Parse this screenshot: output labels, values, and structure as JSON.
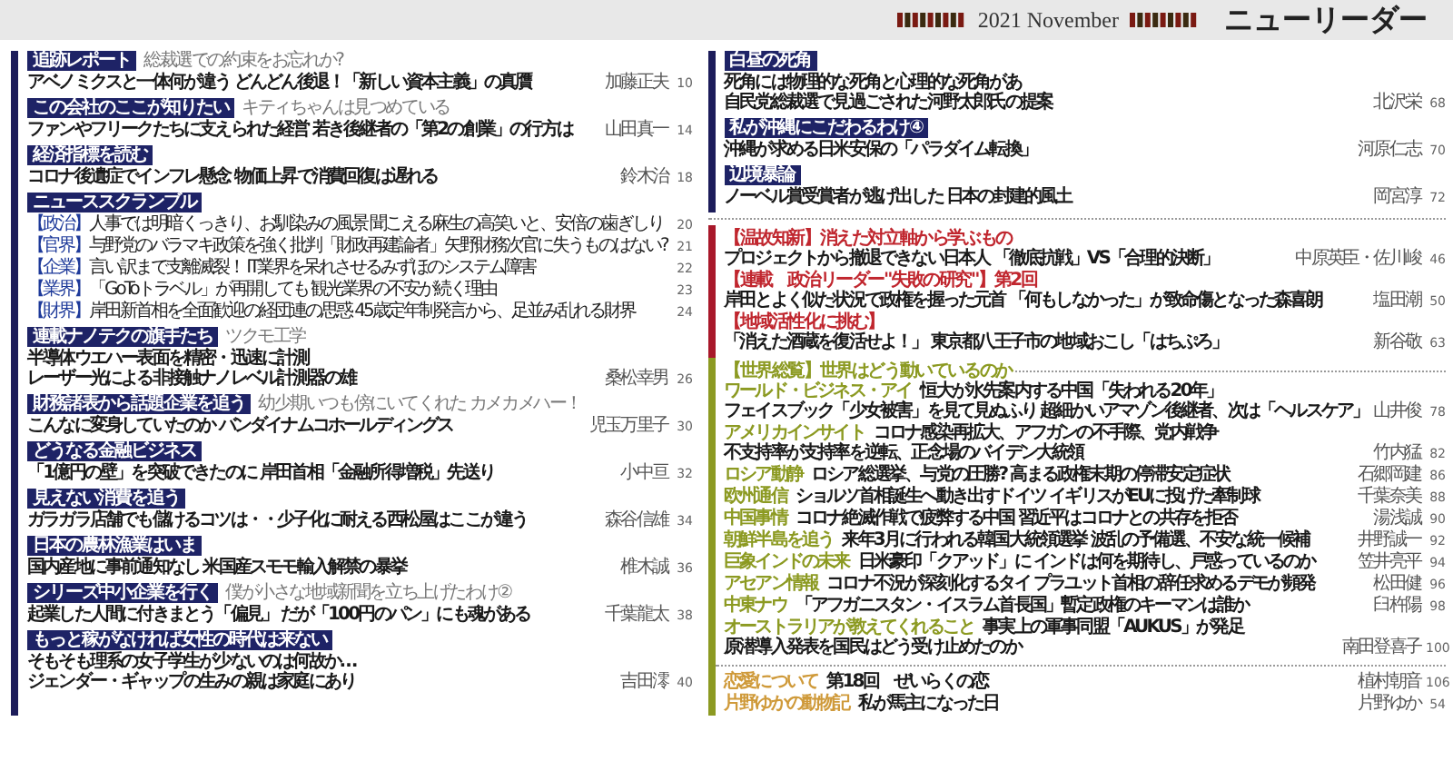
{
  "header": {
    "edition": "2021 November",
    "logo": "ニューリーダー"
  },
  "left_column": {
    "sections": [
      {
        "kind": "article",
        "tag": "追跡レポート",
        "subtitle": "総裁選での約束をお忘れか?",
        "lines": [
          "アベノミクスと一体何が違う どんどん後退！「新しい資本主義」の真贋"
        ],
        "author": "加藤正夫",
        "page": "10"
      },
      {
        "kind": "article",
        "tag": "この会社のここが知りたい",
        "subtitle": "キティちゃんは見つめている",
        "lines": [
          "ファンやフリークたちに支えられた経営 若き後継者の「第2の創業」の行方は"
        ],
        "author": "山田真一",
        "page": "14"
      },
      {
        "kind": "article",
        "tag": "経済指標を読む",
        "lines": [
          "コロナ後遺症でインフレ懸念 物価上昇で消費回復は遅れる"
        ],
        "author": "鈴木治",
        "page": "18"
      },
      {
        "kind": "news",
        "tag": "ニューススクランブル",
        "news": [
          {
            "category": "【政治】",
            "text": "人事では明暗くっきり、お馴染みの風景 聞こえる麻生の高笑いと、安倍の歯ぎしり",
            "page": "20"
          },
          {
            "category": "【官界】",
            "text": "与野党のバラマキ政策を強く批判「財政再建論者」矢野財務次官に失うものはない?",
            "page": "21"
          },
          {
            "category": "【企業】",
            "text": "言い訳まで支離滅裂！ IT業界を呆れさせるみずほのシステム障害",
            "page": "22"
          },
          {
            "category": "【業界】",
            "text": "「GoToトラベル」が再開しても 観光業界の不安が続く理由",
            "page": "23"
          },
          {
            "category": "【財界】",
            "text": "岸田新首相を全面歓迎の経団連の思惑 45歳定年制発言から、足並み乱れる財界",
            "page": "24"
          }
        ]
      },
      {
        "kind": "article",
        "tag": "連載ナノテクの旗手たち",
        "subtitle": "ツクモ工学",
        "lines": [
          "半導体ウエハー表面を精密・迅速に計測",
          "レーザー光による非接触ナノレベル計測器の雄"
        ],
        "author": "桑松幸男",
        "page": "26"
      },
      {
        "kind": "article",
        "tag": "財務諸表から話題企業を追う",
        "subtitle": "幼少期いつも傍にいてくれた カメカメハー！",
        "lines": [
          "こんなに変身していたのか バンダイナムコホールディングス"
        ],
        "author": "児玉万里子",
        "page": "30"
      },
      {
        "kind": "article",
        "tag": "どうなる金融ビジネス",
        "lines": [
          "「1億円の壁」を突破できたのに 岸田首相「金融所得増税」先送り"
        ],
        "author": "小中亘",
        "page": "32"
      },
      {
        "kind": "article",
        "tag": "見えない消費を追う",
        "lines": [
          "ガラガラ店舗でも儲けるコツは・・少子化に耐える西松屋はここが違う"
        ],
        "author": "森谷信雄",
        "page": "34"
      },
      {
        "kind": "article",
        "tag": "日本の農林漁業はいま",
        "lines": [
          "国内産地に事前通知なし 米国産スモモ輸入解禁の暴挙"
        ],
        "author": "椎木誠",
        "page": "36"
      },
      {
        "kind": "article",
        "tag": "シリーズ中小企業を行く",
        "subtitle": "僕が小さな地域新聞を立ち上げたわけ②",
        "lines": [
          "起業した人間に付きまとう「偏見」 だが「100円のパン」にも魂がある"
        ],
        "author": "千葉龍太",
        "page": "38"
      },
      {
        "kind": "article",
        "tag": "もっと稼がなければ女性の時代は来ない",
        "lines": [
          "そもそも理系の女子学生が少ないのは何故か…",
          "ジェンダー・ギャップの生みの親は家庭にあり"
        ],
        "author": "吉田澪",
        "page": "40"
      }
    ]
  },
  "right_column": {
    "top_sections": [
      {
        "tag": "白昼の死角",
        "lines": [
          "死角には物理的な死角と心理的な死角があ",
          "自民党総裁選で見過ごされた河野太郎氏の提案"
        ],
        "author": "北沢栄",
        "page": "68"
      },
      {
        "tag": "私が沖縄にこだわるわけ④",
        "lines": [
          "沖縄が求める日米安保の「パラダイム転換」"
        ],
        "author": "河原仁志",
        "page": "70"
      },
      {
        "tag": "辺境暴論",
        "lines": [
          "ノーベル賞受賞者が逃げ出した 日本の封建的風土"
        ],
        "author": "岡宮淳",
        "page": "72"
      }
    ],
    "red_sections": [
      {
        "heading": "【温故知新】消えた対立軸から学ぶもの",
        "title": "プロジェクトから撤退できない日本人 「徹底抗戦」VS「合理的決断」",
        "author": "中原英臣・佐川峻",
        "page": "46"
      },
      {
        "heading": "【連載　政治リーダー\"失敗の研究\"】第2回",
        "title": "岸田とよく似た状況で政権を握った元首 「何もしなかった」が致命傷となった森喜朗",
        "author": "塩田潮",
        "page": "50"
      },
      {
        "heading": "【地域活性化に挑む】",
        "title": "「消えた酒蔵を復活せよ！」 東京都八王子市の地域おこし「はちぷろ」",
        "author": "新谷敬",
        "page": "63"
      }
    ],
    "world": {
      "heading": "【世界総覧】世界はどう動いているのか",
      "items": [
        {
          "label": "ワールド・ビジネス・アイ",
          "text": "恒大が水先案内する中国「失われる20年」",
          "next_line": "フェイスブック「少女被害」を見て見ぬふり 超細かいアマゾン後継者、次は「ヘルスケア」",
          "author": "山井俊",
          "page": "78"
        },
        {
          "label": "アメリカインサイト",
          "text": "コロナ感染再拡大、アフガンの不手際、党内戦争",
          "next_line": "不支持率が支持率を逆転、正念場のバイデン大統領",
          "author": "竹内猛",
          "page": "82"
        },
        {
          "label": "ロシア動静",
          "text": "ロシア総選挙、与党の圧勝? 高まる政権末期の停滞安定症状",
          "author": "石郷岡建",
          "page": "86"
        },
        {
          "label": "欧州通信",
          "text": "ショルツ首相誕生へ動き出すドイツ イギリスがEUに投げた牽制球",
          "author": "千葉奈美",
          "page": "88"
        },
        {
          "label": "中国事情",
          "text": "コロナ絶滅作戦で疲弊する中国 習近平はコロナとの共存を拒否",
          "author": "湯浅誠",
          "page": "90"
        },
        {
          "label": "朝鮮半島を追う",
          "text": "来年3月に行われる韓国大統領選挙 波乱の予備選、不安な統一候補",
          "author": "井野誠一",
          "page": "92"
        },
        {
          "label": "巨象インドの未来",
          "text": "日米豪印「クアッド」に インドは何を期待し、戸惑っているのか",
          "author": "笠井亮平",
          "page": "94"
        },
        {
          "label": "アセアン情報",
          "text": "コロナ不況が深刻化するタイ プラユット首相の辞任求めるデモが頻発",
          "author": "松田健",
          "page": "96"
        },
        {
          "label": "中東ナウ",
          "text": "「アフガニスタン・イスラム首長国」暫定政権のキーマンは誰か",
          "author": "臼杵陽",
          "page": "98"
        },
        {
          "label": "オーストラリアが教えてくれること",
          "text": "事実上の軍事同盟「AUKUS」が発足",
          "next_line": "原潜導入発表を国民はどう受け止めたのか",
          "author": "南田登喜子",
          "page": "100"
        }
      ],
      "extra_items": [
        {
          "label": "恋愛について",
          "text": "第18回　ぜいらくの恋",
          "author": "植村朝音",
          "page": "106"
        },
        {
          "label": "片野ゆかの動物記",
          "text": "私が馬主になった日",
          "author": "片野ゆか",
          "page": "54"
        }
      ]
    }
  }
}
